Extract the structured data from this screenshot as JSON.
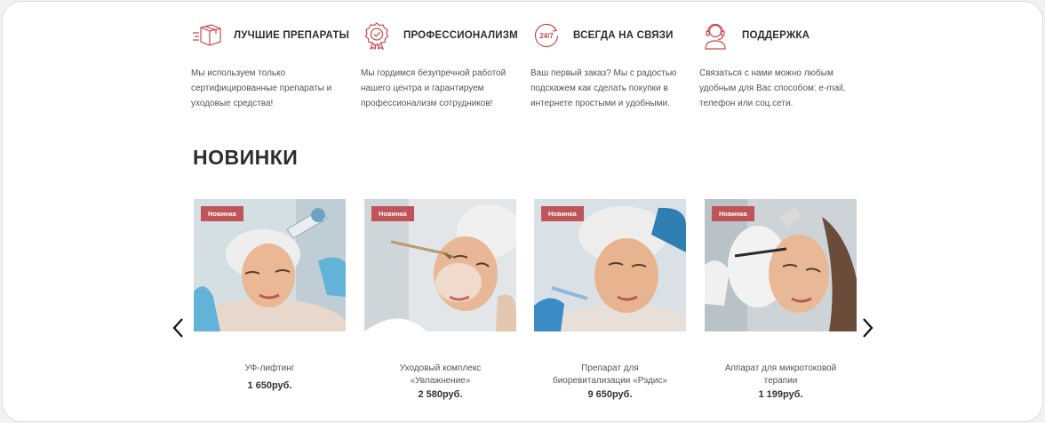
{
  "features": [
    {
      "icon": "box-icon",
      "title": "ЛУЧШИЕ ПРЕПАРАТЫ",
      "text": "Мы используем только сертифицированные препараты и уходовые средства!"
    },
    {
      "icon": "award-badge-icon",
      "title": "ПРОФЕССИОНАЛИЗМ",
      "text": "Мы гордимся безупречной работой нашего центра и гарантируем профессионализм сотрудников!"
    },
    {
      "icon": "24-7-icon",
      "title": "ВСЕГДА НА СВЯЗИ",
      "text": "Ваш первый заказ? Мы с радостью подскажем как сделать покупки в интернете простыми и удобными."
    },
    {
      "icon": "support-operator-icon",
      "title": "ПОДДЕРЖКА",
      "text": "Связаться с нами можно любым удобным для Вас способом: e-mail, телефон или соц.сети."
    }
  ],
  "section_title": "НОВИНКИ",
  "products": [
    {
      "badge": "Новинка",
      "name": "УФ-лифтинг",
      "price": "1 650руб."
    },
    {
      "badge": "Новинка",
      "name": "Уходовый комплекс «Увлажнение»",
      "price": "2 580руб."
    },
    {
      "badge": "Новинка",
      "name": "Препарат для биоревитализации «Рэдис»",
      "price": "9 650руб."
    },
    {
      "badge": "Новинка",
      "name": "Аппарат для микротоковой терапии",
      "price": "1 199руб."
    }
  ],
  "icon_24_7_text": "24/7",
  "colors": {
    "accent": "#c0545b",
    "icon": "#c94a4f",
    "text": "#333333"
  }
}
